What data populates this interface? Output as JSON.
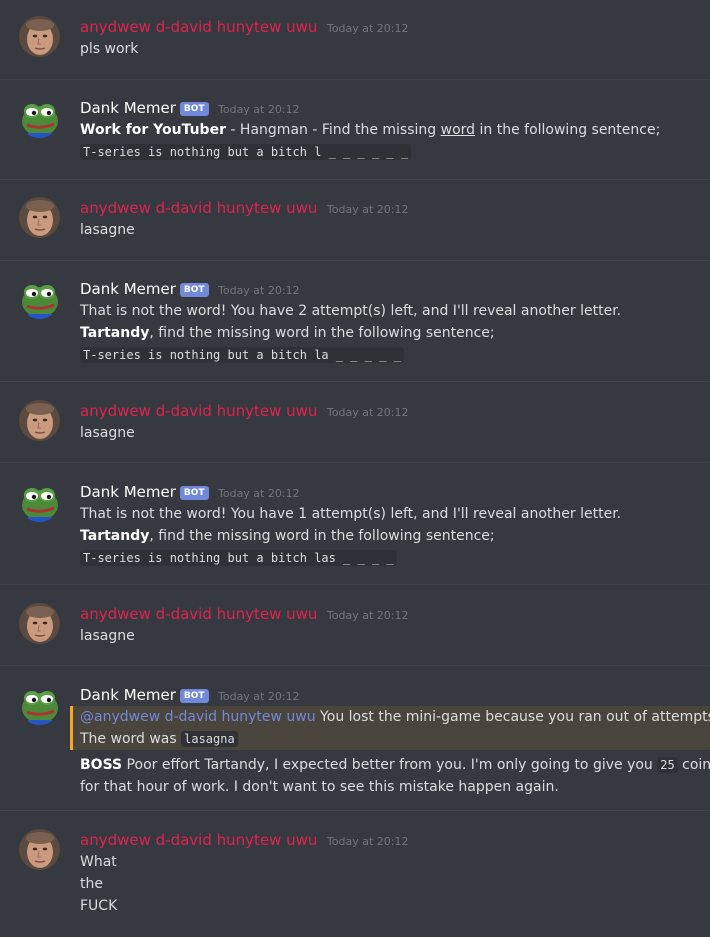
{
  "colors": {
    "background": "#36393f",
    "human_username": "#e0234e",
    "bot_tag": "#7289da",
    "mention": "#7289da",
    "highlight_border": "#faa61a"
  },
  "users": {
    "human": {
      "name": "anydwew d-david hunytew uwu",
      "avatar_icon": "face-avatar"
    },
    "bot": {
      "name": "Dank Memer",
      "tag": "BOT",
      "avatar_icon": "pepe-frog-avatar"
    }
  },
  "messages": [
    {
      "author": "anydwew d-david hunytew uwu",
      "timestamp": "Today at 20:12",
      "lines": [
        "pls work"
      ]
    },
    {
      "author": "Dank Memer",
      "bot_tag": "BOT",
      "timestamp": "Today at 20:12",
      "line1": {
        "bold": "Work for YouTuber",
        "mid": " - Hangman - Find the missing ",
        "underlined": "word",
        "rest": " in the following sentence;"
      },
      "code": "T-series is nothing but a bitch l _ _ _ _ _ _"
    },
    {
      "author": "anydwew d-david hunytew uwu",
      "timestamp": "Today at 20:12",
      "lines": [
        "lasagne"
      ]
    },
    {
      "author": "Dank Memer",
      "bot_tag": "BOT",
      "timestamp": "Today at 20:12",
      "text": "That is not the word! You have 2 attempt(s) left, and I'll reveal another letter.",
      "bold": "Tartandy",
      "rest": ", find the missing word in the following sentence;",
      "code": "T-series is nothing but a bitch la _ _ _ _ _"
    },
    {
      "author": "anydwew d-david hunytew uwu",
      "timestamp": "Today at 20:12",
      "lines": [
        "lasagne"
      ]
    },
    {
      "author": "Dank Memer",
      "bot_tag": "BOT",
      "timestamp": "Today at 20:12",
      "text": "That is not the word! You have 1 attempt(s) left, and I'll reveal another letter.",
      "bold": "Tartandy",
      "rest": ", find the missing word in the following sentence;",
      "code": "T-series is nothing but a bitch las _ _ _ _"
    },
    {
      "author": "anydwew d-david hunytew uwu",
      "timestamp": "Today at 20:12",
      "lines": [
        "lasagne"
      ]
    },
    {
      "author": "Dank Memer",
      "bot_tag": "BOT",
      "timestamp": "Today at 20:12",
      "mention": "@anydwew d-david hunytew uwu",
      "mention_text": " You lost the mini-game because you ran out of attempts.",
      "word_was": "The word was ",
      "word_code": "lasagna",
      "boss_bold": "BOSS",
      "boss_text": " Poor effort Tartandy, I expected better from you. I'm only going to give you ",
      "coins_code": "25",
      "coins_text": " coins",
      "boss_line2": "for that hour of work. I don't want to see this mistake happen again."
    },
    {
      "author": "anydwew d-david hunytew uwu",
      "timestamp": "Today at 20:12",
      "lines": [
        "What",
        "the",
        "FUCK"
      ]
    }
  ]
}
